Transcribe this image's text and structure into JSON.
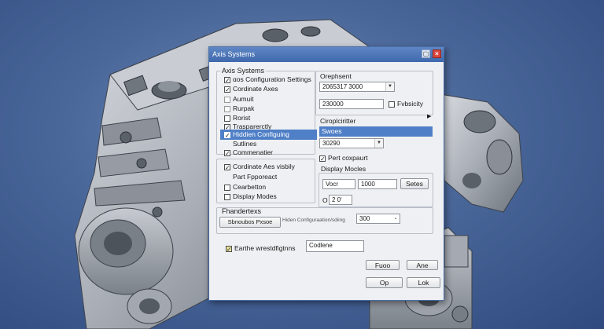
{
  "dialog": {
    "title": "Axis Systems",
    "left_panel": {
      "group_title": "Axis Systems",
      "items": [
        {
          "label": "ɑos Configuration Settings",
          "checked": true
        },
        {
          "label": "Cordinate Axes",
          "checked": true
        },
        {
          "label": "Aumuit",
          "checked": false
        },
        {
          "label": "Rurpak",
          "checked": false
        },
        {
          "label": "Rorist",
          "checked": false
        },
        {
          "label": "Trasparerctly",
          "checked": true
        },
        {
          "label": "Hiddien Configuing",
          "checked": true,
          "selected": true
        },
        {
          "label": "Sutlines",
          "checked": false
        },
        {
          "label": "Commenatier",
          "checked": true
        }
      ],
      "lower_items": [
        {
          "label": "Cordinate Aes visbily",
          "checked": true
        },
        {
          "label": "Part Fpporeact",
          "checked": false
        },
        {
          "label": "Cearbetton",
          "checked": false
        },
        {
          "label": "Display Modes",
          "checked": false
        }
      ]
    },
    "right_panel": {
      "header": "Orephsent",
      "dropdown1": "2065317 3000",
      "field_value": "230000",
      "visibility_label": "Fvbsicity",
      "subheader": "Ciroplciritter",
      "selected_item": "Swoes",
      "dropdown2": "30290",
      "checkbox_label": "Pert coxpaurt",
      "display_modes_label": "Display Mocles",
      "field_a": "Vocr",
      "field_b": "1000",
      "button_a": "Setes",
      "zoom_label": "O",
      "zoom_value": "2 0ʹ"
    },
    "bottom": {
      "group_title": "Fhandertexs",
      "button_label": "Sbnoubos Pxsoe",
      "hint_text": "Hiden Configuraation/sdiing",
      "hint_value": "300",
      "option_label": "Earthe wrestdfigtnns",
      "option_value": "Codlene",
      "buttons": {
        "b1": "Fuoo",
        "b2": "Ane",
        "ok": "Op",
        "lock": "Lok"
      }
    }
  }
}
